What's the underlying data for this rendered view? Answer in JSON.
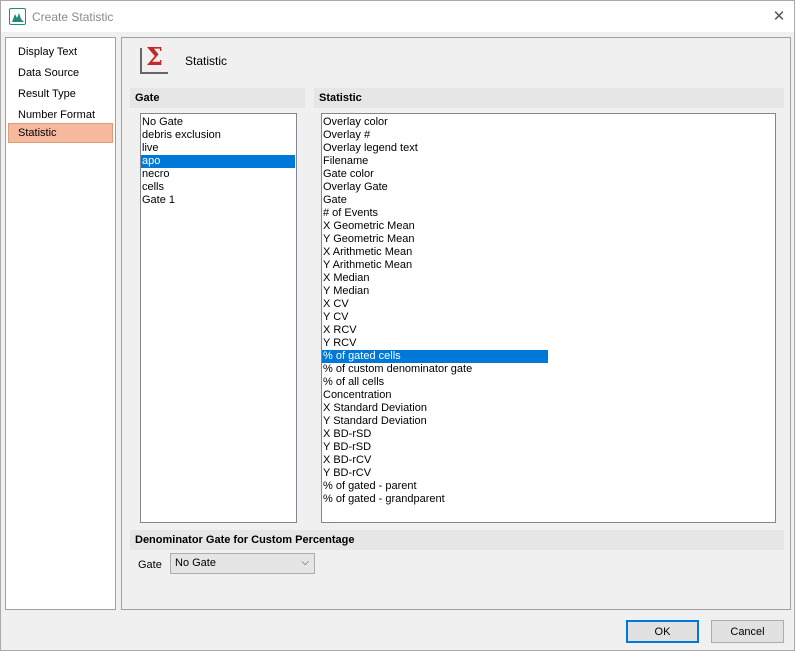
{
  "window": {
    "title": "Create Statistic"
  },
  "nav": {
    "items": [
      "Display Text",
      "Data Source",
      "Result Type",
      "Number Format",
      "Statistic"
    ],
    "selected": "Statistic"
  },
  "header": {
    "title": "Statistic",
    "icon": "sigma-icon"
  },
  "gate_section": {
    "label": "Gate",
    "items": [
      "No Gate",
      "debris exclusion",
      "live",
      "apo",
      "necro",
      "cells",
      "Gate 1"
    ],
    "selected": "apo"
  },
  "statistic_section": {
    "label": "Statistic",
    "items": [
      "Overlay color",
      "Overlay #",
      "Overlay legend text",
      "Filename",
      "Gate color",
      "Overlay Gate",
      "Gate",
      "# of Events",
      "X Geometric Mean",
      "Y Geometric Mean",
      "X Arithmetic Mean",
      "Y Arithmetic Mean",
      "X Median",
      "Y Median",
      "X CV",
      "Y CV",
      "X RCV",
      "Y RCV",
      "% of gated cells",
      "% of custom denominator gate",
      "% of all cells",
      "Concentration",
      "X Standard Deviation",
      "Y Standard Deviation",
      "X BD-rSD",
      "Y BD-rSD",
      "X BD-rCV",
      "Y BD-rCV",
      "% of gated - parent",
      "% of gated - grandparent"
    ],
    "selected": "% of gated cells"
  },
  "denominator": {
    "label": "Denominator Gate for Custom Percentage",
    "gate_label": "Gate",
    "gate_value": "No Gate"
  },
  "buttons": {
    "ok": "OK",
    "cancel": "Cancel"
  },
  "colors": {
    "selection": "#0078d7",
    "nav_selected": "#f6b99f",
    "sigma": "#c62828"
  }
}
